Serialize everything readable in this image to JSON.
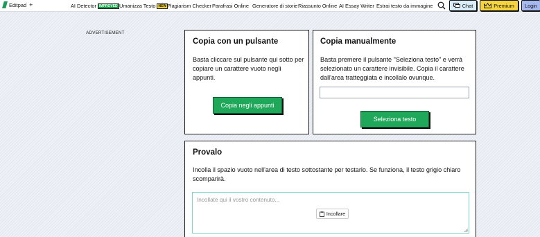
{
  "brand": {
    "name": "Editpad",
    "plus": "+"
  },
  "nav": {
    "items": [
      {
        "label": "AI Detector",
        "badge": "IMPROVED"
      },
      {
        "label": "Umanizza Testo",
        "badge": "NEW"
      },
      {
        "label": "Plagiarism Checker"
      },
      {
        "label": "Parafrasi Online"
      },
      {
        "label": "Generatore di storie"
      },
      {
        "label": "Riassunto Online"
      },
      {
        "label": "AI Essay Writer"
      },
      {
        "label": "Estrai testo da immagine"
      }
    ],
    "chat_label": "Chat",
    "premium_label": "Premium",
    "login_label": "Login"
  },
  "advertisement_label": "ADVERTISEMENT",
  "copy_button_card": {
    "title": "Copia con un pulsante",
    "text": "Basta cliccare sul pulsante qui sotto per copiare un carattere vuoto negli appunti.",
    "button": "Copia negli appunti"
  },
  "copy_manual_card": {
    "title": "Copia manualmente",
    "text": "Basta premere il pulsante \"Seleziona testo\" e verrà selezionato un carattere invisibile. Copia il carattere dall'area tratteggiata e incollalo ovunque.",
    "button": "Seleziona testo"
  },
  "try_card": {
    "title": "Provalo",
    "text": "Incolla il spazio vuoto nell'area di testo sottostante per testarlo. Se funziona, il testo grigio chiaro scomparirà.",
    "placeholder": "Incollate qui il vostro contenuto...",
    "paste_button": "Incollare"
  },
  "colors": {
    "accent_green": "#1fa85a",
    "premium_yellow": "#f7d43c",
    "chat_blue": "#d9ecf7",
    "login_blue": "#a5b9f0",
    "textarea_border": "#7fd6cf"
  }
}
